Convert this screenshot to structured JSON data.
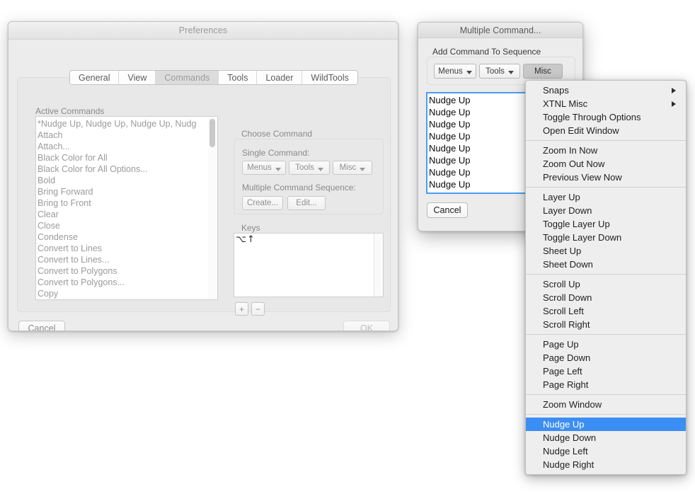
{
  "preferences": {
    "title": "Preferences",
    "tabs": [
      {
        "label": "General",
        "selected": false
      },
      {
        "label": "View",
        "selected": false
      },
      {
        "label": "Commands",
        "selected": true
      },
      {
        "label": "Tools",
        "selected": false
      },
      {
        "label": "Loader",
        "selected": false
      },
      {
        "label": "WildTools",
        "selected": false
      }
    ],
    "active_commands": {
      "label": "Active Commands",
      "items": [
        "*Nudge Up, Nudge Up, Nudge Up, Nudg",
        "Attach",
        "Attach...",
        "Black Color for All",
        "Black Color for All Options...",
        "Bold",
        "Bring Forward",
        "Bring to Front",
        "Clear",
        "Close",
        "Condense",
        "Convert to Lines",
        "Convert to Lines...",
        "Convert to Polygons",
        "Convert to Polygons...",
        "Copy"
      ]
    },
    "choose_command": {
      "label": "Choose Command",
      "single_label": "Single Command:",
      "single_buttons": [
        "Menus",
        "Tools",
        "Misc"
      ],
      "multiple_label": "Multiple Command Sequence:",
      "multiple_buttons": [
        "Create...",
        "Edit..."
      ]
    },
    "keys": {
      "label": "Keys",
      "value": "⌥↑",
      "add_button": "+",
      "remove_button": "−"
    },
    "footer": {
      "cancel": "Cancel",
      "ok": "OK"
    }
  },
  "multiple_command": {
    "title": "Multiple Command...",
    "add_label": "Add Command To Sequence",
    "source_buttons": [
      {
        "label": "Menus",
        "pressed": false
      },
      {
        "label": "Tools",
        "pressed": false
      },
      {
        "label": "Misc",
        "pressed": true
      }
    ],
    "sequence": [
      "Nudge Up",
      "Nudge Up",
      "Nudge Up",
      "Nudge Up",
      "Nudge Up",
      "Nudge Up",
      "Nudge Up",
      "Nudge Up"
    ],
    "cancel": "Cancel"
  },
  "misc_menu": {
    "groups": [
      [
        {
          "label": "Snaps",
          "submenu": true,
          "highlighted": false
        },
        {
          "label": "XTNL Misc",
          "submenu": true,
          "highlighted": false
        },
        {
          "label": "Toggle Through Options",
          "submenu": false,
          "highlighted": false
        },
        {
          "label": "Open Edit Window",
          "submenu": false,
          "highlighted": false
        }
      ],
      [
        {
          "label": "Zoom In Now",
          "submenu": false,
          "highlighted": false
        },
        {
          "label": "Zoom Out Now",
          "submenu": false,
          "highlighted": false
        },
        {
          "label": "Previous View Now",
          "submenu": false,
          "highlighted": false
        }
      ],
      [
        {
          "label": "Layer Up",
          "submenu": false,
          "highlighted": false
        },
        {
          "label": "Layer Down",
          "submenu": false,
          "highlighted": false
        },
        {
          "label": "Toggle Layer Up",
          "submenu": false,
          "highlighted": false
        },
        {
          "label": "Toggle Layer Down",
          "submenu": false,
          "highlighted": false
        },
        {
          "label": "Sheet Up",
          "submenu": false,
          "highlighted": false
        },
        {
          "label": "Sheet Down",
          "submenu": false,
          "highlighted": false
        }
      ],
      [
        {
          "label": "Scroll Up",
          "submenu": false,
          "highlighted": false
        },
        {
          "label": "Scroll Down",
          "submenu": false,
          "highlighted": false
        },
        {
          "label": "Scroll Left",
          "submenu": false,
          "highlighted": false
        },
        {
          "label": "Scroll Right",
          "submenu": false,
          "highlighted": false
        }
      ],
      [
        {
          "label": "Page Up",
          "submenu": false,
          "highlighted": false
        },
        {
          "label": "Page Down",
          "submenu": false,
          "highlighted": false
        },
        {
          "label": "Page Left",
          "submenu": false,
          "highlighted": false
        },
        {
          "label": "Page Right",
          "submenu": false,
          "highlighted": false
        }
      ],
      [
        {
          "label": "Zoom Window",
          "submenu": false,
          "highlighted": false
        }
      ],
      [
        {
          "label": "Nudge Up",
          "submenu": false,
          "highlighted": true
        },
        {
          "label": "Nudge Down",
          "submenu": false,
          "highlighted": false
        },
        {
          "label": "Nudge Left",
          "submenu": false,
          "highlighted": false
        },
        {
          "label": "Nudge Right",
          "submenu": false,
          "highlighted": false
        }
      ]
    ]
  },
  "colors": {
    "selection_blue": "#3b8ef3",
    "focus_ring_blue": "#4a9ef0",
    "window_gray": "#ececec",
    "menu_gray": "#eeeeee",
    "pressed_button_gray": "#c9c9c9"
  }
}
